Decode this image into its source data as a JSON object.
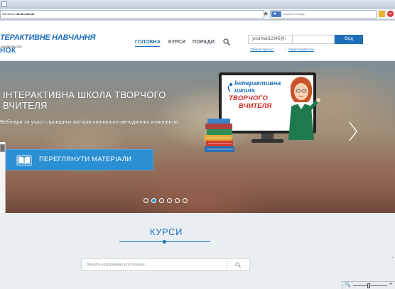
{
  "browser": {
    "url_prefix": "interactive.",
    "url_domain": "ranok.com.ua",
    "search_placeholder": "Искать в Google"
  },
  "header": {
    "logo_title": "ТЕРАКТИВНЕ НАВЧАННЯ",
    "logo_publisher": "ВИДАВНИЦТВО",
    "logo_name": "НОК",
    "nav": [
      {
        "label": "ГОЛОВНА",
        "active": true
      },
      {
        "label": "КУРСИ",
        "active": false
      },
      {
        "label": "ПОРАДИ",
        "active": false
      }
    ],
    "login": {
      "email_value": "yourmail12345@i",
      "password_value": "",
      "submit_label": "Вхід",
      "forgot_label": "Забули пароль?",
      "separator": "•",
      "register_label": "Зареєструватися"
    }
  },
  "hero": {
    "title": "ІНТЕРАКТИВНА ШКОЛА ТВОРЧОГО ВЧИТЕЛЯ",
    "subtitle": "Вебінари за участі провідних авторів навчально-методичних комплектів",
    "button_label": "ПЕРЕГЛЯНУТИ МАТЕРІАЛИ",
    "illustration": {
      "line1": "Інтерактивна",
      "line2": "школа",
      "line3": "ТВОРЧОГО",
      "line4": "ВЧИТЕЛЯ"
    },
    "slides_total": 6,
    "active_slide": 2
  },
  "courses": {
    "title": "КУРСИ",
    "search_placeholder": "Введіть інформацію для пошуку"
  },
  "statusbar": {
    "zoom_icon": "🔍",
    "zoom_plus": "+"
  },
  "colors": {
    "brand_blue": "#1d6fb8",
    "button_blue": "#2a8fd3",
    "accent_red": "#d62828"
  }
}
